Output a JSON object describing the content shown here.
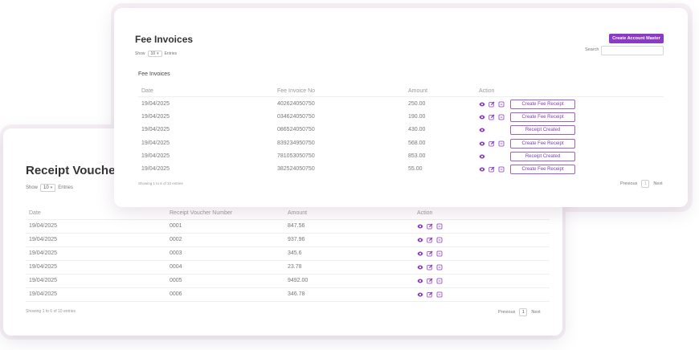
{
  "colors": {
    "accent": "#8a3ac4",
    "icon": "#8a3ac4",
    "card_bg": "#ffffff",
    "glow": "#f7f2f6"
  },
  "receipt_voucher": {
    "title": "Receipt Voucher",
    "show_label": "Show",
    "page_size": "10",
    "entries_label": "Entries",
    "columns": [
      "Date",
      "Receipt Voucher Number",
      "Amount",
      "Action"
    ],
    "rows": [
      {
        "date": "19/04/2025",
        "number": "0001",
        "amount": "847.56"
      },
      {
        "date": "19/04/2025",
        "number": "0002",
        "amount": "937.96"
      },
      {
        "date": "19/04/2025",
        "number": "0003",
        "amount": "345.6"
      },
      {
        "date": "19/04/2025",
        "number": "0004",
        "amount": "23.78"
      },
      {
        "date": "19/04/2025",
        "number": "0005",
        "amount": "9492.00"
      },
      {
        "date": "19/04/2025",
        "number": "0006",
        "amount": "346.78"
      }
    ],
    "footer": "Showing 1 to 6 of 10 entries",
    "pager": {
      "previous": "Previous",
      "page": "1",
      "next": "Next"
    }
  },
  "fee_invoices": {
    "title": "Fee Invoices",
    "show_label": "Show",
    "page_size": "10",
    "entries_label": "Entries",
    "create_button": "Create Account Master",
    "search_label": "Search",
    "search_value": "",
    "subtitle": "Fee Invoices",
    "columns": [
      "Date",
      "Fee Invoice No",
      "Amount",
      "Action"
    ],
    "rows": [
      {
        "date": "19/04/2025",
        "invoice": "402624050750",
        "amount": "250.00",
        "button": "Create Fee Receipt",
        "edit": true
      },
      {
        "date": "19/04/2025",
        "invoice": "034624050750",
        "amount": "190.00",
        "button": "Create Fee Receipt",
        "edit": true
      },
      {
        "date": "19/04/2025",
        "invoice": "086524050750",
        "amount": "430.00",
        "button": "Receipt Created",
        "edit": false
      },
      {
        "date": "19/04/2025",
        "invoice": "839234950750",
        "amount": "568.00",
        "button": "Create Fee Receipt",
        "edit": true
      },
      {
        "date": "19/04/2025",
        "invoice": "781053050750",
        "amount": "853.00",
        "button": "Receipt Created",
        "edit": false
      },
      {
        "date": "19/04/2025",
        "invoice": "382524050750",
        "amount": "55.00",
        "button": "Create Fee Receipt",
        "edit": true
      }
    ],
    "footer": "Showing 1 to 6 of 10 entries",
    "pager": {
      "previous": "Previous",
      "page": "1",
      "next": "Next"
    }
  },
  "icons": {
    "view": "eye-icon",
    "edit": "edit-icon",
    "delete": "delete-icon",
    "caret": "chevron-down-icon"
  }
}
